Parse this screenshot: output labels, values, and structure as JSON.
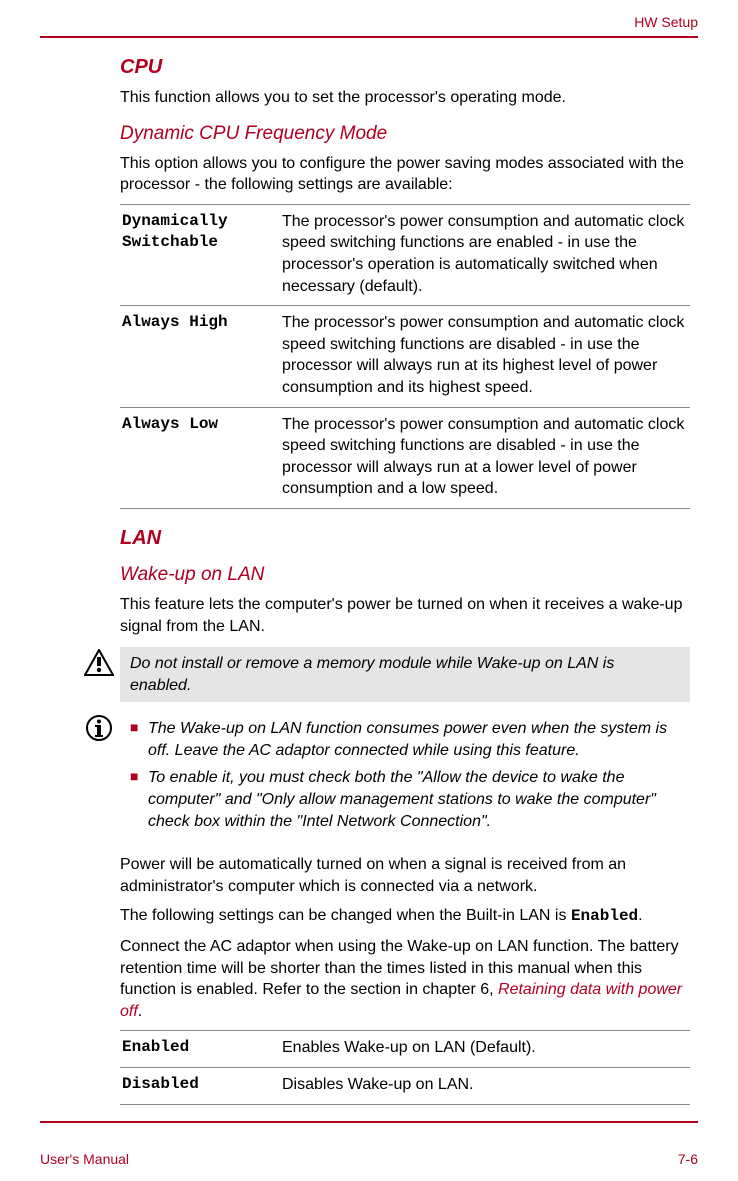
{
  "header": {
    "section": "HW Setup"
  },
  "cpu": {
    "title": "CPU",
    "intro": "This function allows you to set the processor's operating mode.",
    "freq": {
      "title": "Dynamic CPU Frequency Mode",
      "intro": "This option allows you to configure the power saving modes associated with the processor - the following settings are available:",
      "rows": [
        {
          "k": "Dynamically Switchable",
          "v": "The processor's power consumption and automatic clock speed switching functions are enabled - in use the processor's operation is automatically switched when necessary (default)."
        },
        {
          "k": "Always High",
          "v": "The processor's power consumption and automatic clock speed switching functions are disabled - in use the processor will always run at its highest level of power consumption and its highest speed."
        },
        {
          "k": "Always Low",
          "v": "The processor's power consumption and automatic clock speed switching functions are disabled - in use the processor will always run at a lower level of power consumption and a low speed."
        }
      ]
    }
  },
  "lan": {
    "title": "LAN",
    "wol": {
      "title": "Wake-up on LAN",
      "intro": "This feature lets the computer's power be turned on when it receives a wake-up signal from the LAN.",
      "warn": "Do not install or remove a memory module while Wake-up on LAN is enabled.",
      "info": [
        "The Wake-up on LAN function consumes power even when the system is off. Leave the AC adaptor connected while using this feature.",
        "To enable it, you must check both the \"Allow the device to wake the computer\" and \"Only allow management stations to wake the computer\" check box within the \"Intel Network Connection\"."
      ],
      "p1": "Power will be automatically turned on when a signal is received from an administrator's computer which is connected via a network.",
      "p2a": "The following settings can be changed when the Built-in LAN is ",
      "p2b": "Enabled",
      "p2c": ".",
      "p3a": "Connect the AC adaptor when using the Wake-up on LAN function. The battery retention time will be shorter than the times listed in this manual when this function is enabled. Refer to the section in chapter 6, ",
      "p3link": "Retaining data with power off",
      "p3b": ".",
      "rows": [
        {
          "k": "Enabled",
          "v": "Enables Wake-up on LAN (Default)."
        },
        {
          "k": "Disabled",
          "v": "Disables Wake-up on LAN."
        }
      ]
    }
  },
  "footer": {
    "left": "User's Manual",
    "right": "7-6"
  }
}
